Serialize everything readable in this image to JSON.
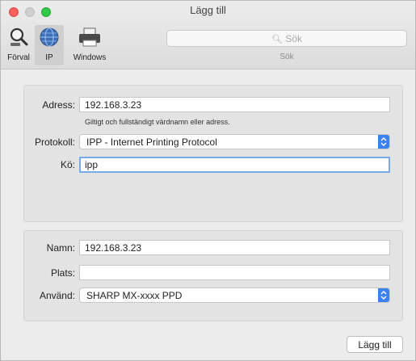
{
  "window": {
    "title": "Lägg till"
  },
  "toolbar": {
    "items": [
      {
        "label": "Förval",
        "icon": "magnifier-icon"
      },
      {
        "label": "IP",
        "icon": "globe-icon"
      },
      {
        "label": "Windows",
        "icon": "printer-icon"
      }
    ],
    "search": {
      "placeholder": "Sök",
      "label": "Sök"
    }
  },
  "form": {
    "address": {
      "label": "Adress:",
      "value": "192.168.3.23",
      "hint": "Giltigt och fullständigt värdnamn eller adress."
    },
    "protocol": {
      "label": "Protokoll:",
      "value": "IPP - Internet Printing Protocol"
    },
    "queue": {
      "label": "Kö:",
      "value": "ipp"
    },
    "name": {
      "label": "Namn:",
      "value": "192.168.3.23"
    },
    "location": {
      "label": "Plats:",
      "value": ""
    },
    "use": {
      "label": "Använd:",
      "value": "SHARP MX-xxxx PPD"
    }
  },
  "buttons": {
    "add": "Lägg till"
  },
  "colors": {
    "accent": "#3c82ef",
    "focus": "#7aa9e8",
    "close": "#fc605c",
    "maximize": "#34c84a"
  }
}
